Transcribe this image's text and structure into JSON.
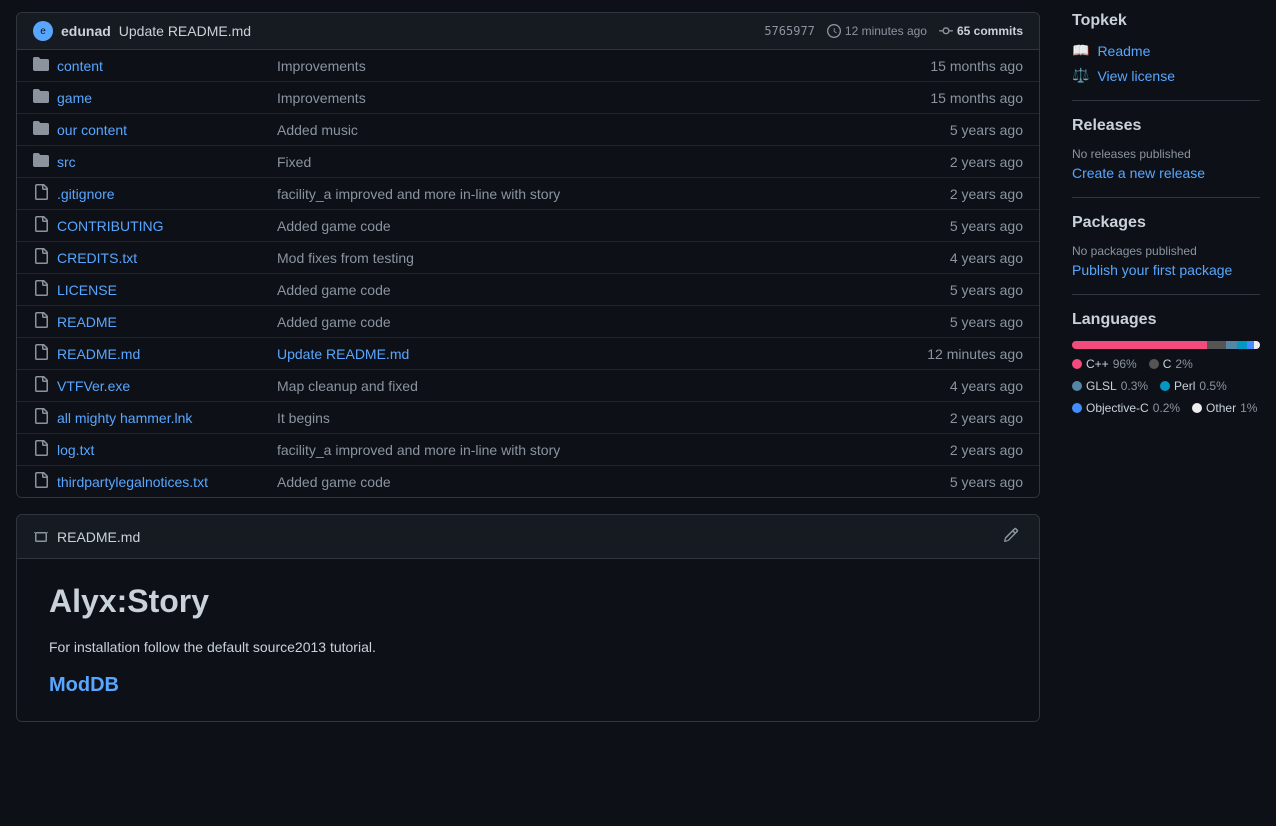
{
  "sidebar_title": "Topkek",
  "sidebar_links": [
    {
      "id": "readme",
      "icon": "📖",
      "label": "Readme"
    },
    {
      "id": "license",
      "icon": "⚖️",
      "label": "View license"
    }
  ],
  "releases": {
    "title": "Releases",
    "no_content": "No releases published",
    "create_link": "Create a new release"
  },
  "packages": {
    "title": "Packages",
    "no_content": "No packages published",
    "publish_link": "Publish your first package"
  },
  "languages": {
    "title": "Languages",
    "bar": [
      {
        "name": "C++",
        "pct": 96.0,
        "color": "#f34b7d",
        "width": "72%"
      },
      {
        "name": "C",
        "pct": 2.0,
        "color": "#555555",
        "width": "10%"
      },
      {
        "name": "GLSL",
        "pct": 0.3,
        "color": "#5686a5",
        "width": "6%"
      },
      {
        "name": "Perl",
        "pct": 0.5,
        "color": "#0298c3",
        "width": "5%"
      },
      {
        "name": "Objective-C",
        "pct": 0.2,
        "color": "#438eff",
        "width": "4%"
      },
      {
        "name": "Other",
        "pct": 1.0,
        "color": "#ededed",
        "width": "3%"
      }
    ]
  },
  "commit": {
    "avatar_initial": "e",
    "author": "edunad",
    "message": "Update README.md",
    "hash": "5765977",
    "time": "12 minutes ago",
    "commits_count": "65 commits"
  },
  "files": [
    {
      "type": "folder",
      "name": "content",
      "commit": "Improvements",
      "time": "15 months ago"
    },
    {
      "type": "folder",
      "name": "game",
      "commit": "Improvements",
      "time": "15 months ago"
    },
    {
      "type": "folder",
      "name": "our content",
      "commit": "Added music",
      "time": "5 years ago"
    },
    {
      "type": "folder",
      "name": "src",
      "commit": "Fixed",
      "time": "2 years ago"
    },
    {
      "type": "file",
      "name": ".gitignore",
      "commit": "facility_a improved and more in-line with story",
      "time": "2 years ago"
    },
    {
      "type": "file",
      "name": "CONTRIBUTING",
      "commit": "Added game code",
      "time": "5 years ago"
    },
    {
      "type": "file",
      "name": "CREDITS.txt",
      "commit": "Mod fixes from testing",
      "time": "4 years ago"
    },
    {
      "type": "file",
      "name": "LICENSE",
      "commit": "Added game code",
      "time": "5 years ago"
    },
    {
      "type": "file",
      "name": "README",
      "commit": "Added game code",
      "time": "5 years ago"
    },
    {
      "type": "file",
      "name": "README.md",
      "commit": "Update README.md",
      "time": "12 minutes ago",
      "commit_link": true
    },
    {
      "type": "file",
      "name": "VTFVer.exe",
      "commit": "Map cleanup and fixed",
      "time": "4 years ago"
    },
    {
      "type": "file",
      "name": "all mighty hammer.lnk",
      "commit": "It begins",
      "time": "2 years ago"
    },
    {
      "type": "file",
      "name": "log.txt",
      "commit": "facility_a improved and more in-line with story",
      "time": "2 years ago"
    },
    {
      "type": "file",
      "name": "thirdpartylegalnotices.txt",
      "commit": "Added game code",
      "time": "5 years ago"
    }
  ],
  "readme": {
    "filename": "README.md",
    "title": "Alyx:Story",
    "description": "For installation follow the default source2013 tutorial.",
    "link_text": "ModDB"
  }
}
